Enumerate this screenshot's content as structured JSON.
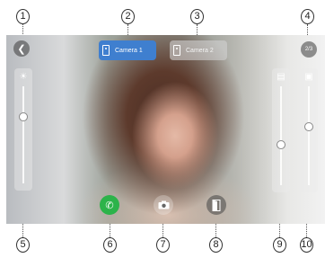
{
  "callouts": [
    "1",
    "2",
    "3",
    "4",
    "5",
    "6",
    "7",
    "8",
    "9",
    "10"
  ],
  "screen": {
    "tabs": [
      {
        "label": "Camera 1",
        "active": true,
        "color": "#3f7fcf"
      },
      {
        "label": "Camera 2",
        "active": false
      }
    ],
    "battery_text": "2/3",
    "icons": {
      "back": "back-arrow-icon",
      "brightness": "brightness-icon",
      "call": "phone-icon",
      "snapshot": "camera-icon",
      "unlock": "door-icon",
      "volume": "volume-icon",
      "contrast": "picture-icon"
    },
    "sliders": [
      {
        "id": "brightness",
        "level": 0.7
      },
      {
        "id": "volume",
        "level": 0.4
      },
      {
        "id": "contrast",
        "level": 0.6
      }
    ],
    "colors": {
      "call_button": "#2cb34a",
      "active_tab": "#3f7fcf"
    }
  }
}
